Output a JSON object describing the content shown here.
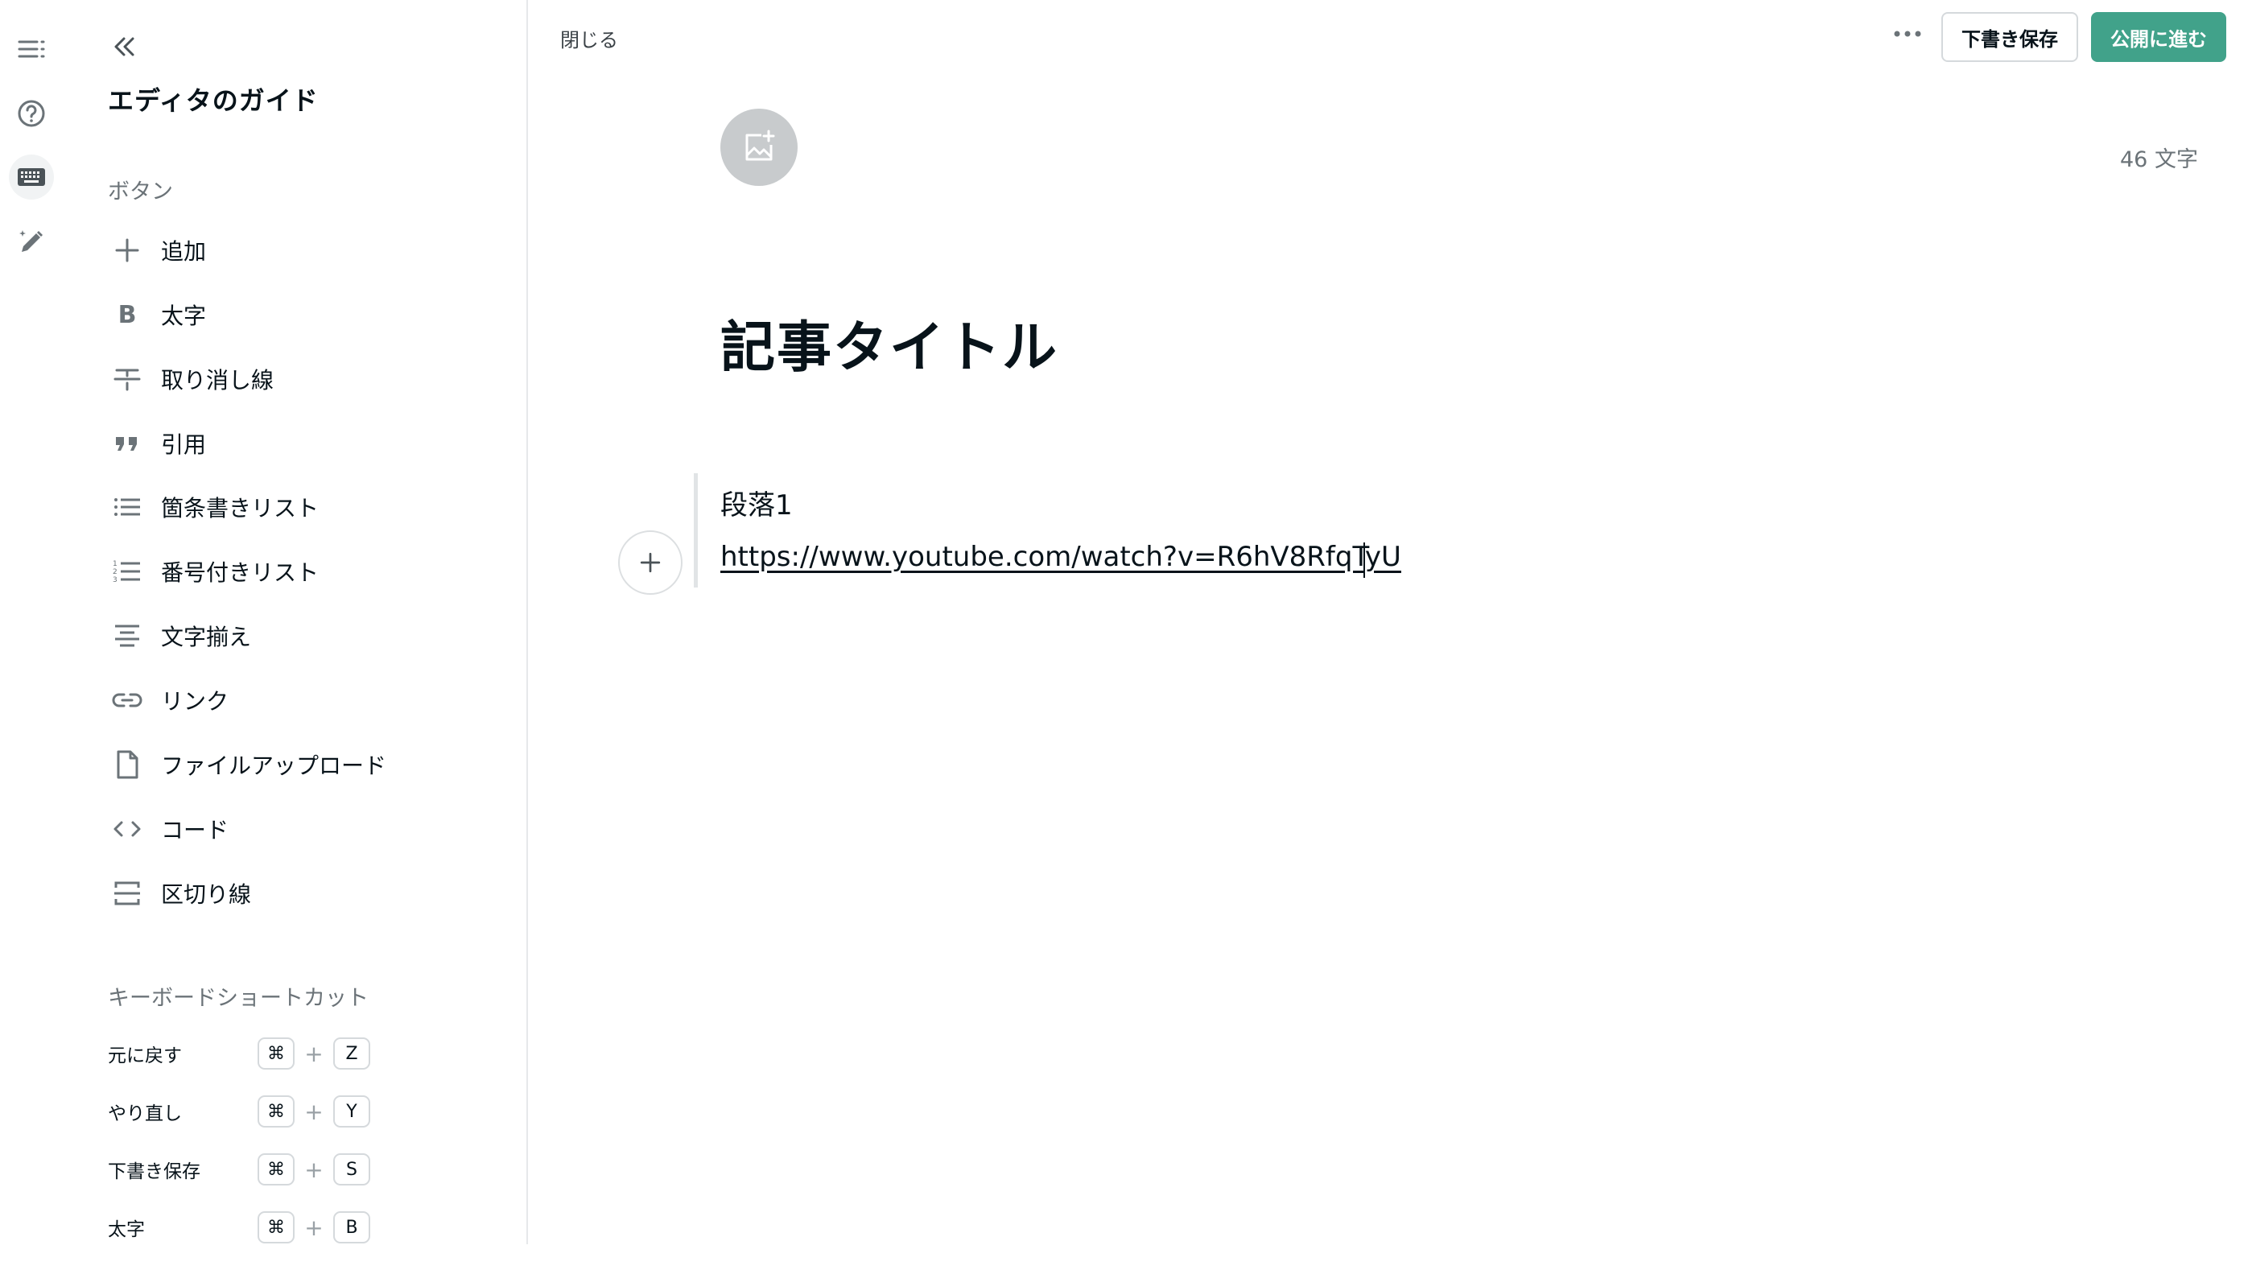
{
  "rail": {
    "icons": [
      "menu-icon",
      "help-icon",
      "keyboard-icon",
      "magic-pen-icon"
    ]
  },
  "sidebar": {
    "title": "エディタのガイド",
    "buttons_heading": "ボタン",
    "buttons": [
      {
        "label": "追加",
        "icon": "plus-icon"
      },
      {
        "label": "太字",
        "icon": "bold-icon"
      },
      {
        "label": "取り消し線",
        "icon": "strikethrough-icon"
      },
      {
        "label": "引用",
        "icon": "quote-icon"
      },
      {
        "label": "箇条書きリスト",
        "icon": "bulleted-list-icon"
      },
      {
        "label": "番号付きリスト",
        "icon": "numbered-list-icon"
      },
      {
        "label": "文字揃え",
        "icon": "align-center-icon"
      },
      {
        "label": "リンク",
        "icon": "link-icon"
      },
      {
        "label": "ファイルアップロード",
        "icon": "file-icon"
      },
      {
        "label": "コード",
        "icon": "code-icon"
      },
      {
        "label": "区切り線",
        "icon": "divider-icon"
      }
    ],
    "shortcuts_heading": "キーボードショートカット",
    "shortcuts": [
      {
        "name": "元に戻す",
        "mod": "⌘",
        "plus": "+",
        "key": "Z"
      },
      {
        "name": "やり直し",
        "mod": "⌘",
        "plus": "+",
        "key": "Y"
      },
      {
        "name": "下書き保存",
        "mod": "⌘",
        "plus": "+",
        "key": "S"
      },
      {
        "name": "太字",
        "mod": "⌘",
        "plus": "+",
        "key": "B"
      }
    ]
  },
  "topbar": {
    "close_label": "閉じる",
    "draft_label": "下書き保存",
    "publish_label": "公開に進む"
  },
  "editor": {
    "char_count": "46 文字",
    "title": "記事タイトル",
    "paragraph": "段落1",
    "url": "https://www.youtube.com/watch?v=R6hV8RfqTyU"
  },
  "colors": {
    "accent": "#41a28a",
    "text": "#08131a",
    "muted": "#6b7378"
  }
}
